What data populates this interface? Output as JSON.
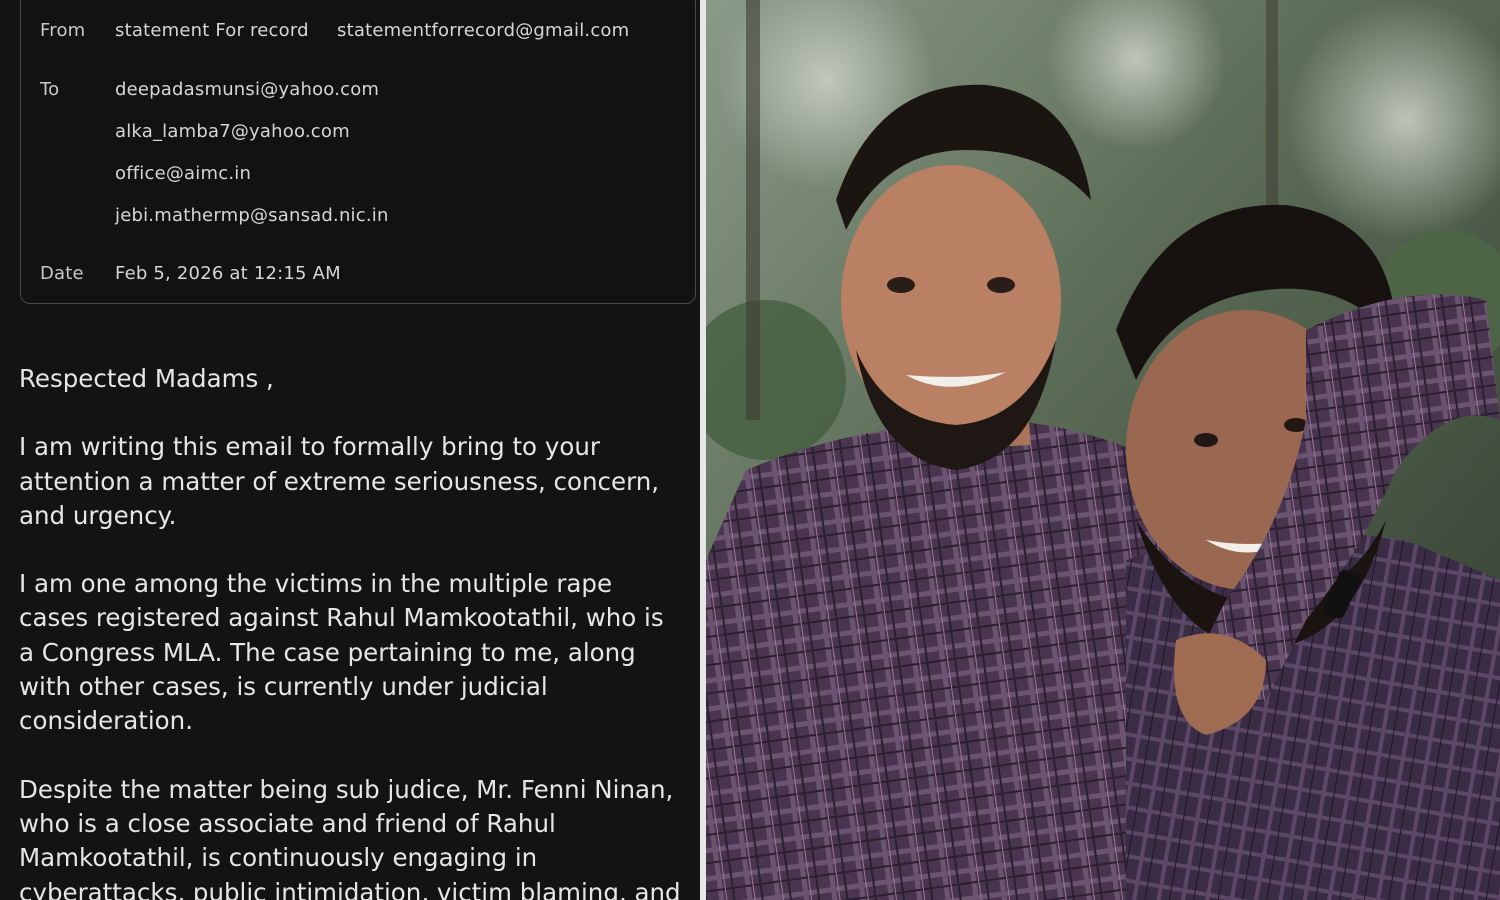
{
  "email": {
    "from_label": "From",
    "from_name": "statement For record",
    "from_address": "statementforrecord@gmail.com",
    "to_label": "To",
    "to_addresses": [
      "deepadasmunsi@yahoo.com",
      "alka_lamba7@yahoo.com",
      "office@aimc.in",
      "jebi.mathermp@sansad.nic.in"
    ],
    "date_label": "Date",
    "date_value": "Feb 5, 2026 at 12:15 AM",
    "body": {
      "greeting": "Respected Madams ,",
      "p1": "I am writing this email to formally bring to your\nattention a matter of extreme seriousness, concern,\nand urgency.",
      "p2": "I am one among the victims in the multiple rape\ncases registered against Rahul Mamkootathil, who is\na Congress MLA. The case pertaining to me, along\nwith other cases, is currently under judicial\nconsideration.",
      "p3": "Despite the matter being sub judice, Mr. Fenni Ninan,\nwho is a close associate and friend of Rahul\nMamkootathil, is continuously engaging in\ncyberattacks, public intimidation, victim blaming, and"
    }
  },
  "photo": {
    "alt": "Two smiling men in checked shirts, one with his arm around the other"
  },
  "colors": {
    "panel_bg": "#131313",
    "text": "#e6e6e6",
    "border": "#4a4a4a"
  }
}
